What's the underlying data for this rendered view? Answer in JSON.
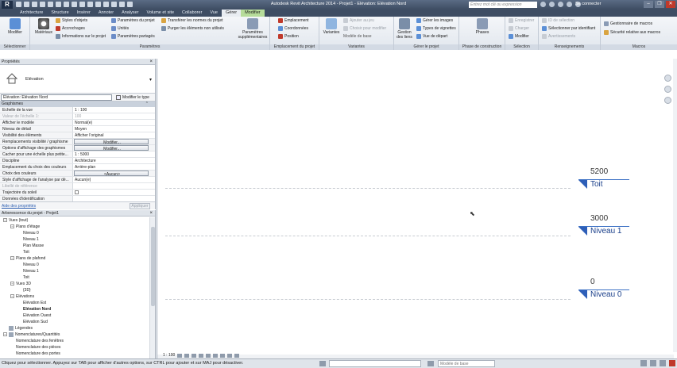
{
  "app": {
    "menu_button": "R",
    "title": "Autodesk Revit Architecture 2014 -    Projet1 - Elévation: Elévation Nord",
    "search_placeholder": "Entrez mot clé ou expression",
    "sign_in": "Se connecter",
    "window_controls": [
      "–",
      "❐",
      "✕"
    ]
  },
  "tabs": [
    "Architecture",
    "Structure",
    "Insérer",
    "Annoter",
    "Analyser",
    "Volume et site",
    "Collaborer",
    "Vue",
    "Gérer",
    "Modifier"
  ],
  "active_tab": "Gérer",
  "ribbon": {
    "panels": {
      "select": "Sélectionner",
      "settings": "Paramètres",
      "location": "Emplacement du projet",
      "variants": "Variantes",
      "manage_project": "Gérer le projet",
      "phasing": "Phase de construction",
      "selection": "Sélection",
      "inquiry": "Renseignements",
      "macros": "Macros"
    },
    "modify": "Modifier",
    "materials": "Matériaux",
    "object_styles": "Styles d'objets",
    "snaps": "Accrochages",
    "project_info": "Informations sur le projet",
    "project_params": "Paramètres du projet",
    "units": "Unités",
    "shared_params": "Paramètres partagés",
    "transfer_standards": "Transférer les normes du projet",
    "purge": "Purger les éléments non utilisés",
    "additional_settings": "Paramètres supplémentaires",
    "location": "Emplacement",
    "coordinates": "Coordonnées",
    "position": "Position",
    "design_options": "Variantes",
    "add_to_set": "Ajouter au jeu",
    "pick_to_edit": "Choisir pour modifier",
    "main_model": "Modèle de base",
    "manage_links": "Gestion des liens",
    "manage_images": "Gérer les images",
    "starting_view": "Vue de départ",
    "decal_types": "Types de vignettes",
    "phases": "Phases",
    "save": "Enregistrer",
    "load": "Charger",
    "edit": "Modifier",
    "select_by_id": "ID de sélection",
    "select_by_id2": "Sélectionner par identifiant",
    "warnings": "Avertissements",
    "macro_manager": "Gestionnaire de macros",
    "macro_security": "Sécurité relative aux macros"
  },
  "properties": {
    "title": "Propriétés",
    "type_name": "Elévation",
    "instance_selector": "Elévation: Elévation Nord",
    "edit_type": "Modifier le type",
    "group": "Graphismes",
    "rows": [
      {
        "k": "Echelle de la vue",
        "v": "1 : 100"
      },
      {
        "k": "Valeur de l'échelle    1:",
        "v": "100"
      },
      {
        "k": "Afficher le modèle",
        "v": "Normal(e)"
      },
      {
        "k": "Niveau de détail",
        "v": "Moyen"
      },
      {
        "k": "Visibilité des éléments",
        "v": "Afficher l'original"
      },
      {
        "k": "Remplacements visibilité / graphisme",
        "v": "Modifier..."
      },
      {
        "k": "Options d'affichage des graphismes",
        "v": "Modifier..."
      },
      {
        "k": "Cacher pour une échelle plus petite...",
        "v": "1 : 5000"
      },
      {
        "k": "Discipline",
        "v": "Architecture"
      },
      {
        "k": "Emplacement du choix des couleurs",
        "v": "Arrière-plan"
      },
      {
        "k": "Choix des couleurs",
        "v": "<Aucun>"
      },
      {
        "k": "Style d'affichage de l'analyse par dé...",
        "v": "Aucun(e)"
      },
      {
        "k": "Libellé de référence",
        "v": ""
      },
      {
        "k": "Trajectoire du soleil",
        "v": ""
      },
      {
        "k": "Données d'identification",
        "v": ""
      }
    ],
    "help_link": "Aide des propriétés",
    "apply": "Appliquer"
  },
  "browser": {
    "title": "Arborescence du projet - Projet1",
    "tree": [
      {
        "label": "Vues (tout)",
        "level": 0,
        "exp": "−"
      },
      {
        "label": "Plans d'étage",
        "level": 1,
        "exp": "−"
      },
      {
        "label": "Niveau 0",
        "level": 2
      },
      {
        "label": "Niveau 1",
        "level": 2
      },
      {
        "label": "Plan Masse",
        "level": 2
      },
      {
        "label": "Toit",
        "level": 2
      },
      {
        "label": "Plans de plafond",
        "level": 1,
        "exp": "−"
      },
      {
        "label": "Niveau 0",
        "level": 2
      },
      {
        "label": "Niveau 1",
        "level": 2
      },
      {
        "label": "Toit",
        "level": 2
      },
      {
        "label": "Vues 3D",
        "level": 1,
        "exp": "−"
      },
      {
        "label": "{3D}",
        "level": 2
      },
      {
        "label": "Elévations",
        "level": 1,
        "exp": "−"
      },
      {
        "label": "Elévation Est",
        "level": 2
      },
      {
        "label": "Elévation Nord",
        "level": 2,
        "bold": true
      },
      {
        "label": "Elévation Ouest",
        "level": 2
      },
      {
        "label": "Elévation Sud",
        "level": 2
      },
      {
        "label": "Légendes",
        "level": 0,
        "icon": true
      },
      {
        "label": "Nomenclatures/Quantités",
        "level": 0,
        "exp": "−",
        "icon": true
      },
      {
        "label": "Nomenclature des fenêtres",
        "level": 1
      },
      {
        "label": "Nomenclature des pièces",
        "level": 1
      },
      {
        "label": "Nomenclature des portes",
        "level": 1
      }
    ]
  },
  "levels": [
    {
      "value": "5200",
      "name": "Toit"
    },
    {
      "value": "3000",
      "name": "Niveau 1"
    },
    {
      "value": "0",
      "name": "Niveau 0"
    }
  ],
  "viewbar": {
    "scale": "1 : 100"
  },
  "status": {
    "text": "Cliquez pour sélectionner. Appuyez sur TAB pour afficher d'autres options, sur CTRL pour ajouter et sur MAJ pour désactiver.",
    "model_combo": "Modèle de base"
  }
}
